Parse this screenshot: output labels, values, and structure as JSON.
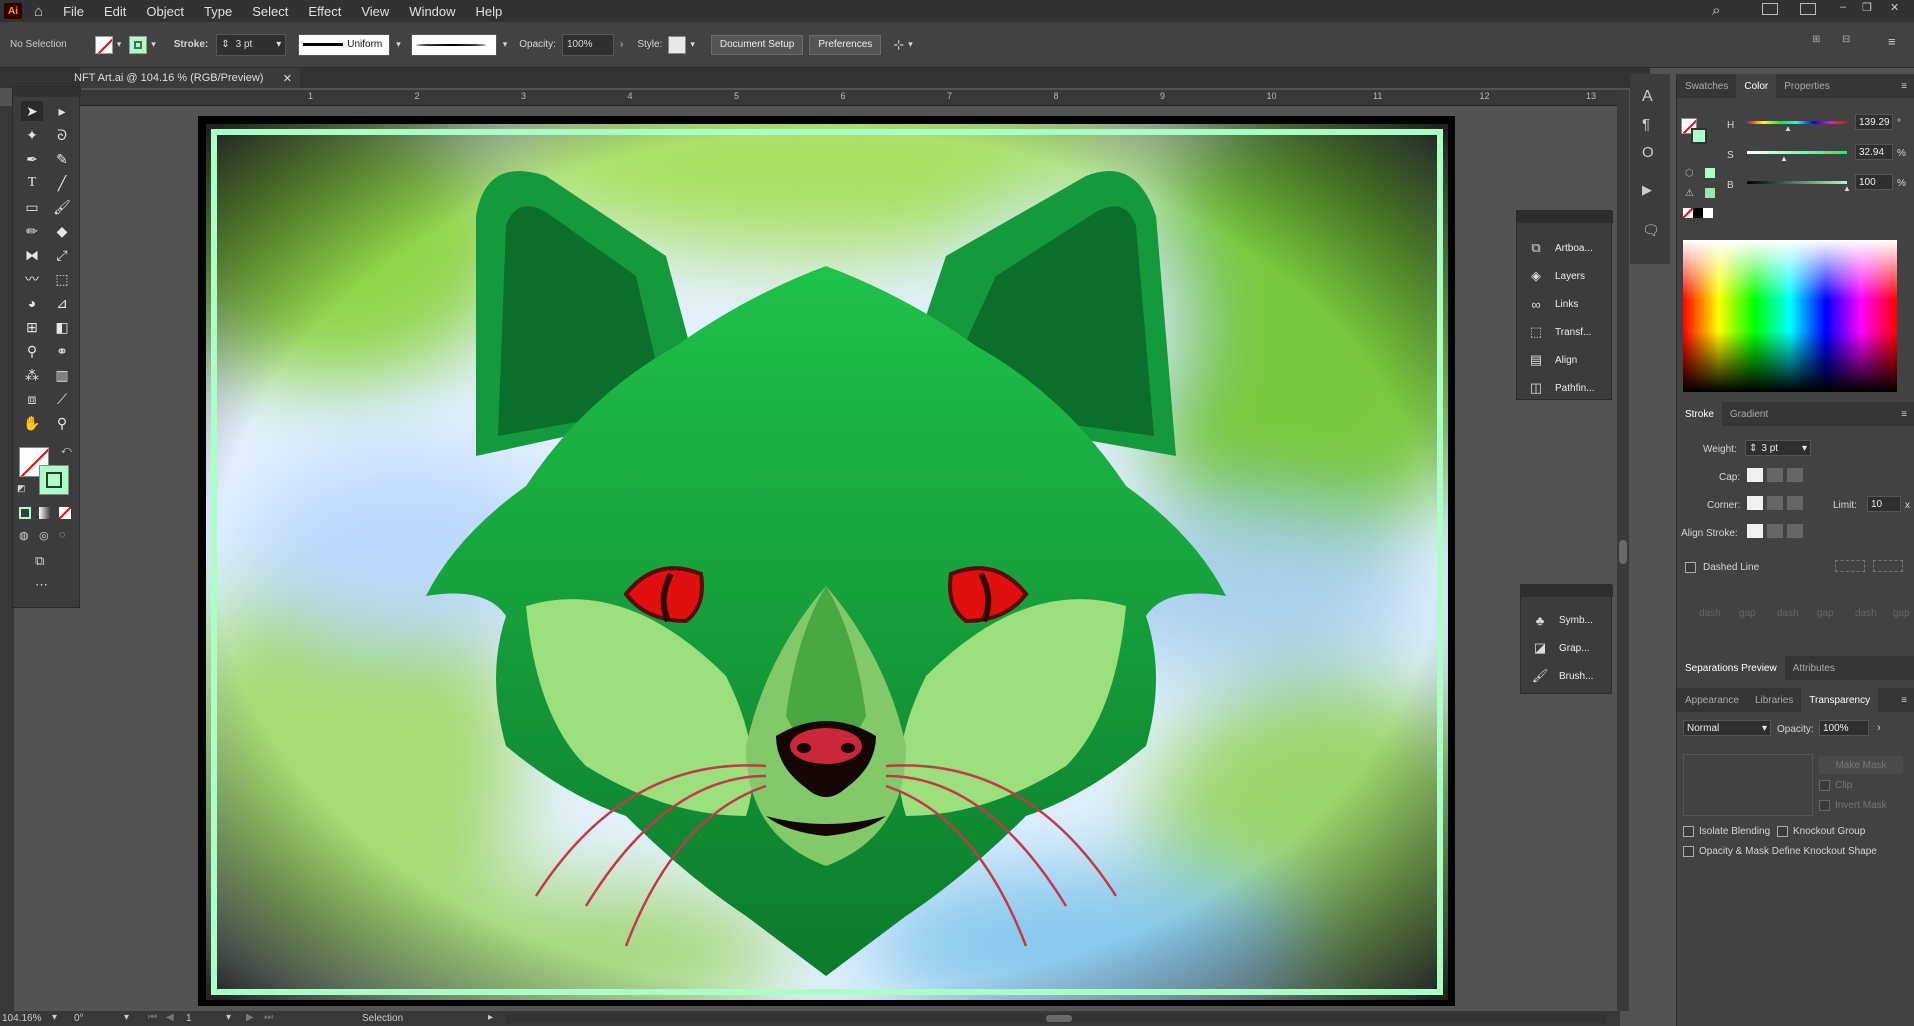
{
  "app": {
    "logo": "Ai"
  },
  "menu": [
    "File",
    "Edit",
    "Object",
    "Type",
    "Select",
    "Effect",
    "View",
    "Window",
    "Help"
  ],
  "control": {
    "selection": "No Selection",
    "stroke_label": "Stroke:",
    "stroke_weight": "3 pt",
    "profile": "Uniform",
    "opacity_label": "Opacity:",
    "opacity": "100%",
    "style_label": "Style:",
    "document_setup": "Document Setup",
    "preferences": "Preferences"
  },
  "document": {
    "tab_title": "NFT Art.ai @ 104.16 % (RGB/Preview)"
  },
  "ruler_labels": [
    "1",
    "2",
    "3",
    "4",
    "5",
    "6",
    "7",
    "8",
    "9",
    "10",
    "11",
    "12",
    "13"
  ],
  "mini_panel_1": [
    "Artboa...",
    "Layers",
    "Links",
    "Transf...",
    "Align",
    "Pathfin..."
  ],
  "mini_panel_2": [
    "Symb...",
    "Grap...",
    "Brush..."
  ],
  "color_panel": {
    "tabs": [
      "Swatches",
      "Color",
      "Properties"
    ],
    "active": "Color",
    "h_label": "H",
    "h_value": "139.29",
    "h_unit": "°",
    "s_label": "S",
    "s_value": "32.94",
    "s_unit": "%",
    "b_label": "B",
    "b_value": "100",
    "b_unit": "%",
    "fill_color": "#aaffc6"
  },
  "stroke_panel": {
    "tabs": [
      "Stroke",
      "Gradient"
    ],
    "weight_label": "Weight:",
    "weight": "3 pt",
    "cap_label": "Cap:",
    "corner_label": "Corner:",
    "limit_label": "Limit:",
    "limit": "10",
    "limit_unit": "x",
    "align_label": "Align Stroke:",
    "dashed_line": "Dashed Line",
    "dash_labels": [
      "dash",
      "gap",
      "dash",
      "gap",
      "dash",
      "gap"
    ]
  },
  "sep_tabs": [
    "Separations Preview",
    "Attributes"
  ],
  "transparency_panel": {
    "tabs": [
      "Appearance",
      "Libraries",
      "Transparency"
    ],
    "blend_mode": "Normal",
    "opacity_label": "Opacity:",
    "opacity": "100%",
    "make_mask": "Make Mask",
    "clip": "Clip",
    "invert_mask": "Invert Mask",
    "isolate_blending": "Isolate Blending",
    "knockout_group": "Knockout Group",
    "opacity_mask": "Opacity & Mask Define Knockout Shape"
  },
  "status": {
    "zoom": "104.16%",
    "rotation": "0°",
    "artboard": "1",
    "tool": "Selection"
  },
  "colors": {
    "accent_frame": "#aaffc6",
    "fox_green": "#18b83c",
    "eye_red": "#e01010"
  }
}
